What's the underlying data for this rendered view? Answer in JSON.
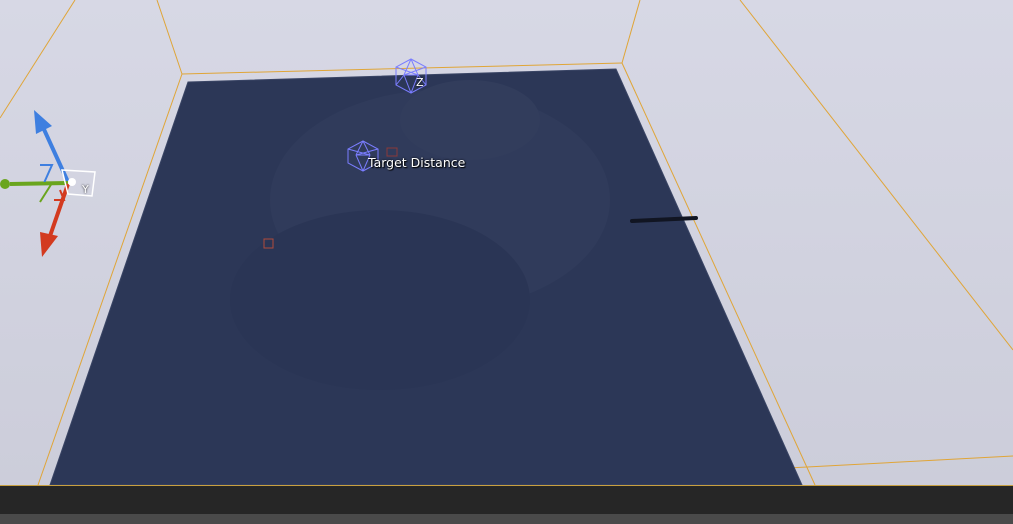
{
  "viewport": {
    "actor_label": "Target Distance",
    "gizmo_z_label": "Z",
    "gizmo_y_label": "Y"
  },
  "colors": {
    "background": "#cfd0dd",
    "plane": "#2c3757",
    "bounds_outline": "#e0a537",
    "gizmo_x": "#d33a1f",
    "gizmo_y": "#6aa51e",
    "gizmo_z": "#3e7fe0",
    "wire_sphere": "#7a7dff"
  }
}
